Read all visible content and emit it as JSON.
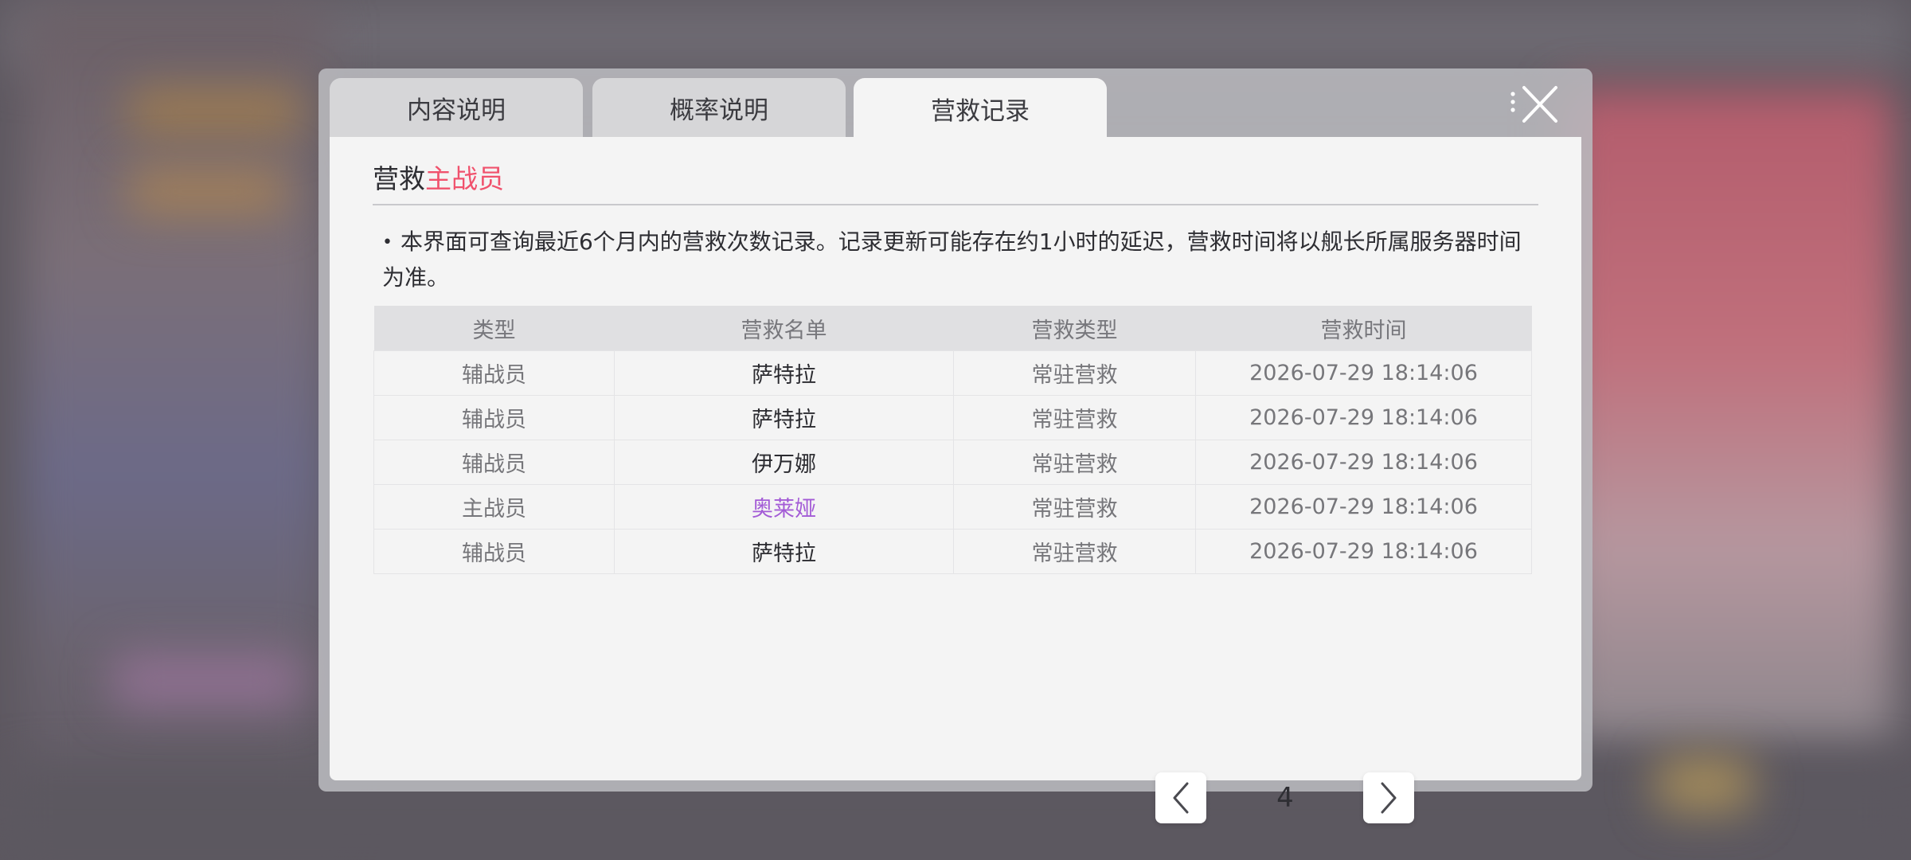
{
  "tabs": [
    {
      "label": "内容说明"
    },
    {
      "label": "概率说明"
    },
    {
      "label": "营救记录"
    }
  ],
  "section": {
    "title_prefix": "营救",
    "title_accent": "主战员",
    "accent_color": "#f0526d"
  },
  "notice": "本界面可查询最近6个月内的营救次数记录。记录更新可能存在约1小时的延迟，营救时间将以舰长所属服务器时间为准。",
  "table": {
    "headers": [
      "类型",
      "营救名单",
      "营救类型",
      "营救时间"
    ],
    "rows": [
      {
        "type": "辅战员",
        "name": "萨特拉",
        "rescue_type": "常驻营救",
        "time": "2026-07-29 18:14:06"
      },
      {
        "type": "辅战员",
        "name": "萨特拉",
        "rescue_type": "常驻营救",
        "time": "2026-07-29 18:14:06"
      },
      {
        "type": "辅战员",
        "name": "伊万娜",
        "rescue_type": "常驻营救",
        "time": "2026-07-29 18:14:06"
      },
      {
        "type": "主战员",
        "name": "奥莱娅",
        "rescue_type": "常驻营救",
        "time": "2026-07-29 18:14:06"
      },
      {
        "type": "辅战员",
        "name": "萨特拉",
        "rescue_type": "常驻营救",
        "time": "2026-07-29 18:14:06"
      }
    ],
    "highlight_name_color": "#a35bd6"
  },
  "pagination": {
    "current_page": "4"
  },
  "icons": {
    "close": "close-icon",
    "prev": "chevron-left-icon",
    "next": "chevron-right-icon"
  }
}
